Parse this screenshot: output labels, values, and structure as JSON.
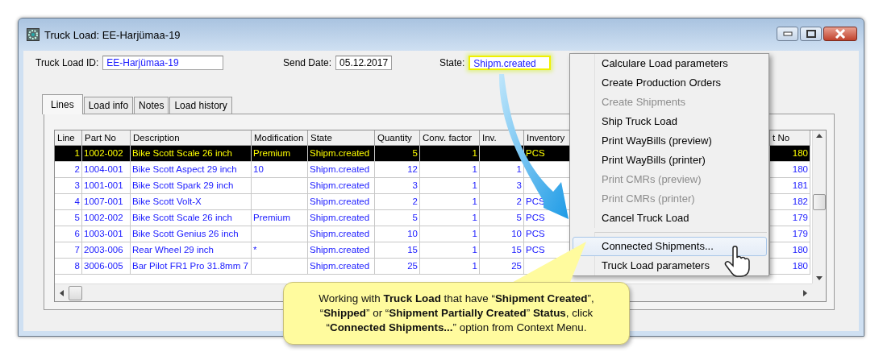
{
  "window": {
    "title": "Truck Load: EE-Harjümaa-19"
  },
  "fields": [
    {
      "kind": "id",
      "label": "Truck Load ID:",
      "value": "EE-Harjümaa-19",
      "highlighted": false
    },
    {
      "kind": "date",
      "label": "Send Date:",
      "value": "05.12.2017",
      "highlighted": false
    },
    {
      "kind": "state",
      "label": "State:",
      "value": "Shipm.created",
      "highlighted": true
    }
  ],
  "tabs": [
    {
      "label": "Lines",
      "selected": true
    },
    {
      "label": "Load info",
      "selected": false
    },
    {
      "label": "Notes",
      "selected": false
    },
    {
      "label": "Load history",
      "selected": false
    }
  ],
  "table": {
    "columns": [
      "Line",
      "Part No",
      "Description",
      "Modification",
      "State",
      "Quantity",
      "Conv. factor",
      "Inv.",
      "Inventory",
      "t No"
    ],
    "rows": [
      {
        "selected": true,
        "cells": [
          "1",
          "1002-002",
          "Bike Scott Scale 26 inch",
          "Premium",
          "Shipm.created",
          "5",
          "1",
          null,
          "PCS",
          "180"
        ]
      },
      {
        "selected": false,
        "cells": [
          "2",
          "1004-001",
          "Bike Scott Aspect 29 inch",
          "10",
          "Shipm.created",
          "12",
          "1",
          "1",
          null,
          "180"
        ]
      },
      {
        "selected": false,
        "cells": [
          "3",
          "1001-001",
          "Bike Scott Spark 29 inch",
          null,
          "Shipm.created",
          "3",
          "1",
          "3",
          null,
          "181"
        ]
      },
      {
        "selected": false,
        "cells": [
          "4",
          "1007-001",
          "Bike Scott Volt-X",
          null,
          "Shipm.created",
          "2",
          "1",
          "2",
          "PCS",
          "182"
        ]
      },
      {
        "selected": false,
        "cells": [
          "5",
          "1002-002",
          "Bike Scott Scale 26 inch",
          "Premium",
          "Shipm.created",
          "5",
          "1",
          "5",
          "PCS",
          "179"
        ]
      },
      {
        "selected": false,
        "cells": [
          "6",
          "1003-001",
          "Bike Scott Genius 26 inch",
          null,
          "Shipm.created",
          "10",
          "1",
          "10",
          "PCS",
          "179"
        ]
      },
      {
        "selected": false,
        "cells": [
          "7",
          "2003-006",
          "Rear Wheel 29 inch",
          "*",
          "Shipm.created",
          "15",
          "1",
          "15",
          "PCS",
          "180"
        ]
      },
      {
        "selected": false,
        "cells": [
          "8",
          "3006-005",
          "Bar Pilot FR1 Pro 31.8mm 7",
          null,
          "Shipm.created",
          "25",
          "1",
          "25",
          null,
          "180"
        ]
      }
    ]
  },
  "context_menu": {
    "groups": [
      [
        {
          "label": "Calculare Load parameters",
          "disabled": false,
          "highlighted": false
        },
        {
          "label": "Create Production Orders",
          "disabled": false,
          "highlighted": false
        },
        {
          "label": "Create Shipments",
          "disabled": true,
          "highlighted": false
        },
        {
          "label": "Ship Truck Load",
          "disabled": false,
          "highlighted": false
        },
        {
          "label": "Print WayBills (preview)",
          "disabled": false,
          "highlighted": false
        },
        {
          "label": "Print WayBills (printer)",
          "disabled": false,
          "highlighted": false
        },
        {
          "label": "Print CMRs (preview)",
          "disabled": true,
          "highlighted": false
        },
        {
          "label": "Print CMRs (printer)",
          "disabled": true,
          "highlighted": false
        },
        {
          "label": "Cancel Truck Load",
          "disabled": false,
          "highlighted": false
        }
      ],
      [
        {
          "label": "Connected Shipments...",
          "disabled": false,
          "highlighted": true
        },
        {
          "label": "Truck Load parameters",
          "disabled": false,
          "highlighted": false
        }
      ]
    ]
  },
  "callout": {
    "text": "Working with **Truck Load** that have “**Shipment Created**”, “**Shipped**” or “**Shipment Partially Created**” **Status**, click “**Connected Shipments...**” option from Context Menu."
  }
}
